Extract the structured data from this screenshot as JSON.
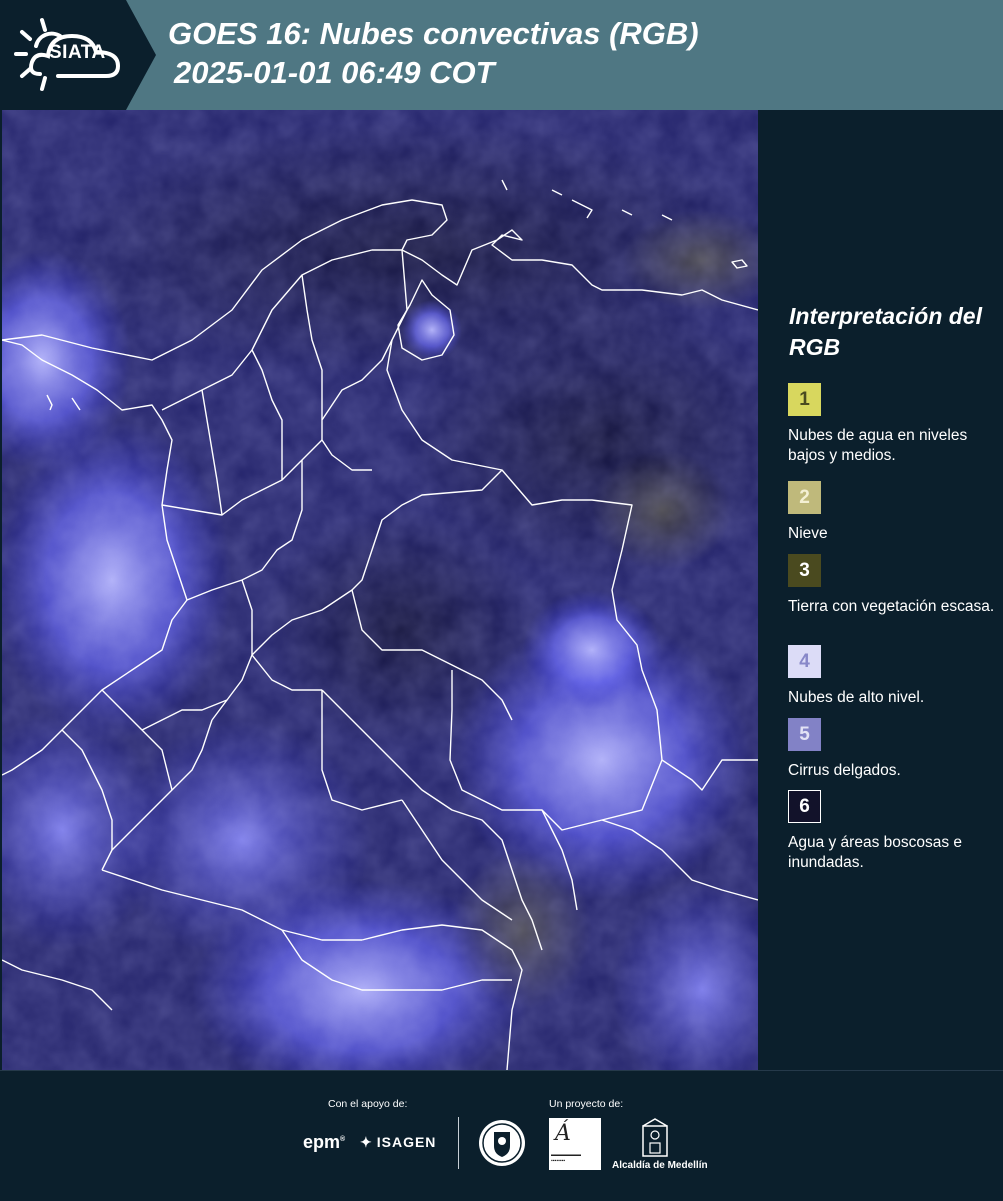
{
  "header": {
    "logo_text": "SIATA",
    "title_line1": "GOES 16: Nubes convectivas (RGB)",
    "title_line2": "2025-01-01 06:49 COT"
  },
  "legend": {
    "title": "Interpretación del RGB",
    "items": [
      {
        "number": "1",
        "label": "Nubes de agua en niveles bajos y medios.",
        "color": "#d8d75e",
        "text_color": "#4a4a20"
      },
      {
        "number": "2",
        "label": "Nieve",
        "color": "#bfb97b",
        "text_color": "#f4f0d4"
      },
      {
        "number": "3",
        "label": "Tierra con vegetación escasa.",
        "color": "#4a4a1f",
        "text_color": "#ffffff"
      },
      {
        "number": "4",
        "label": "Nubes de alto nivel.",
        "color": "#dcdcf7",
        "text_color": "#8888c8"
      },
      {
        "number": "5",
        "label": "Cirrus delgados.",
        "color": "#8282c6",
        "text_color": "#e2e2f5"
      },
      {
        "number": "6",
        "label": "Agua y áreas boscosas e inundadas.",
        "color": "#12122a",
        "text_color": "#ffffff"
      }
    ]
  },
  "footer": {
    "sponsor_label": "Con el apoyo de:",
    "project_label": "Un proyecto de:",
    "sponsors": [
      "epm",
      "ISAGEN"
    ],
    "partners": [
      "Alcaldía de Medellín"
    ]
  }
}
